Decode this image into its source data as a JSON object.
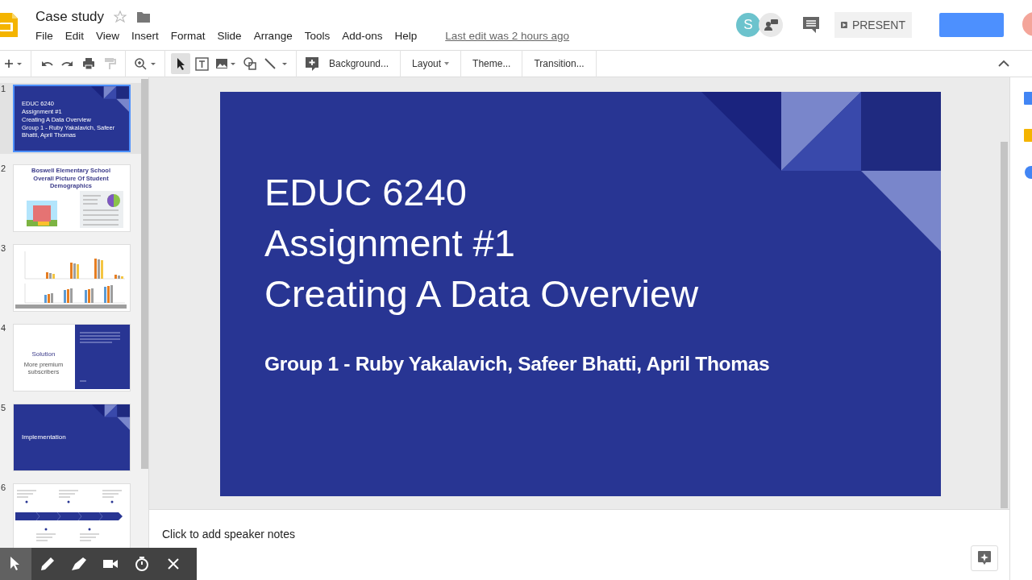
{
  "document": {
    "title": "Case study",
    "last_edit": "Last edit was 2 hours ago"
  },
  "menu": [
    "File",
    "Edit",
    "View",
    "Insert",
    "Format",
    "Slide",
    "Arrange",
    "Tools",
    "Add-ons",
    "Help"
  ],
  "header": {
    "avatar_letter": "S",
    "present_label": "PRESENT"
  },
  "toolbar": {
    "tools": [
      {
        "kind": "new",
        "selected": false
      },
      {
        "kind": "undo",
        "selected": false
      },
      {
        "kind": "redo",
        "selected": false
      },
      {
        "kind": "print",
        "selected": false
      },
      {
        "kind": "paint",
        "selected": false
      },
      {
        "kind": "zoom",
        "selected": false
      },
      {
        "kind": "select",
        "selected": true
      },
      {
        "kind": "textbox",
        "selected": false
      },
      {
        "kind": "image",
        "selected": false
      },
      {
        "kind": "shape",
        "selected": false
      },
      {
        "kind": "line",
        "selected": false
      },
      {
        "kind": "comment",
        "selected": false
      }
    ],
    "buttons": [
      {
        "label": "Background...",
        "dropdown": false
      },
      {
        "label": "Layout",
        "dropdown": true
      },
      {
        "label": "Theme...",
        "dropdown": false
      },
      {
        "label": "Transition...",
        "dropdown": false
      }
    ]
  },
  "slides": [
    {
      "number": "1",
      "kind": "title",
      "selected": true,
      "texts": [
        "EDUC 6240",
        "Assignment #1",
        "Creating A Data Overview",
        "Group 1 - Ruby Yakalavich, Safeer Bhatti, April Thomas"
      ]
    },
    {
      "number": "2",
      "kind": "demographics",
      "selected": false,
      "texts": [
        "Boswell Elementary School",
        "Overall Picture Of Student Demographics"
      ]
    },
    {
      "number": "3",
      "kind": "chart",
      "selected": false
    },
    {
      "number": "4",
      "kind": "solution",
      "selected": false,
      "texts": [
        "Solution",
        "More premium subscribers"
      ]
    },
    {
      "number": "5",
      "kind": "section",
      "selected": false,
      "texts": [
        "Implementation"
      ]
    },
    {
      "number": "6",
      "kind": "timeline",
      "selected": false
    }
  ],
  "current_slide": {
    "title_lines": [
      "EDUC 6240",
      "Assignment #1",
      "Creating A Data Overview"
    ],
    "subtitle": "Group 1 - Ruby Yakalavich, Safeer Bhatti, April Thomas"
  },
  "notes": {
    "placeholder": "Click to add speaker notes"
  },
  "recorder_tools": [
    {
      "kind": "pointer",
      "selected": true
    },
    {
      "kind": "pen",
      "selected": false
    },
    {
      "kind": "highlighter",
      "selected": false
    },
    {
      "kind": "camera",
      "selected": false
    },
    {
      "kind": "timer",
      "selected": false
    },
    {
      "kind": "close",
      "selected": false
    }
  ]
}
